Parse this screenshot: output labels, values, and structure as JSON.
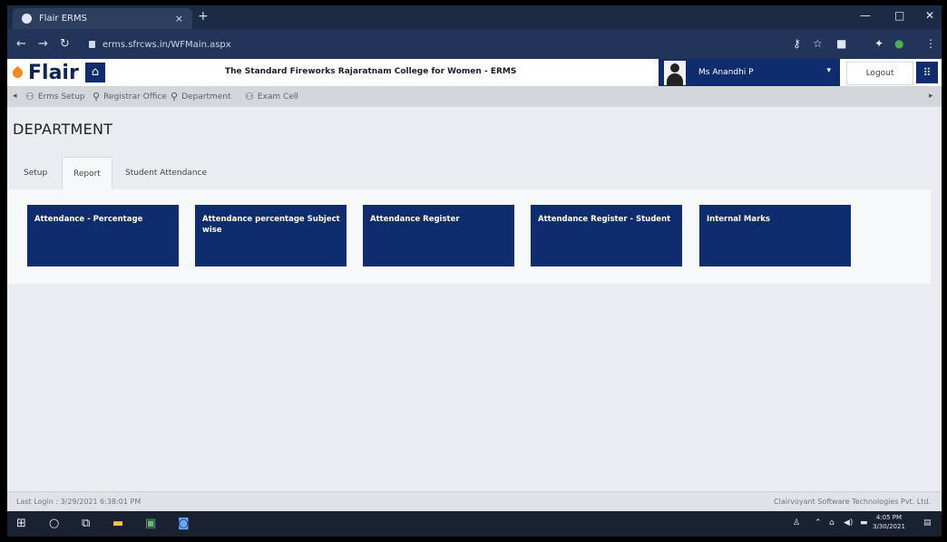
{
  "browser": {
    "tab_title": "Flair ERMS",
    "tab_close": "×",
    "new_tab": "+",
    "url": "erms.sfrcws.in/WFMain.aspx",
    "minimize": "—",
    "maximize": "□",
    "close": "✕"
  },
  "header": {
    "logo_text": "Flair",
    "home_icon": "⌂",
    "college_name": "The Standard Fireworks Rajaratnam College for Women - ERMS",
    "user_name": "Ms Anandhi P",
    "user_caret": "▾",
    "logout_label": "Logout",
    "grid_icon": "⠿"
  },
  "menu": {
    "left_arrow": "◂",
    "right_arrow": "▸",
    "items": [
      {
        "label": "Erms Setup",
        "icon": "users-icon"
      },
      {
        "label": "Registrar Office",
        "icon": "user-icon"
      },
      {
        "label": "Department",
        "icon": "user-icon"
      },
      {
        "label": "Exam Cell",
        "icon": "users-icon"
      }
    ]
  },
  "page": {
    "title": "DEPARTMENT",
    "tabs": [
      "Setup",
      "Report",
      "Student Attendance"
    ],
    "active_tab": "Report",
    "tiles": [
      "Attendance - Percentage",
      "Attendance percentage Subject wise",
      "Attendance Register",
      "Attendance Register - Student",
      "Internal Marks"
    ]
  },
  "footer": {
    "last_login": "Last Login : 3/29/2021 6:38:01 PM",
    "copyright": "Clairvoyant Software Technologies Pvt. Ltd."
  },
  "taskbar": {
    "time": "4:05 PM",
    "date": "3/30/2021"
  },
  "colors": {
    "brand_navy": "#0f2d6e",
    "logo_orange": "#f28a1e"
  }
}
